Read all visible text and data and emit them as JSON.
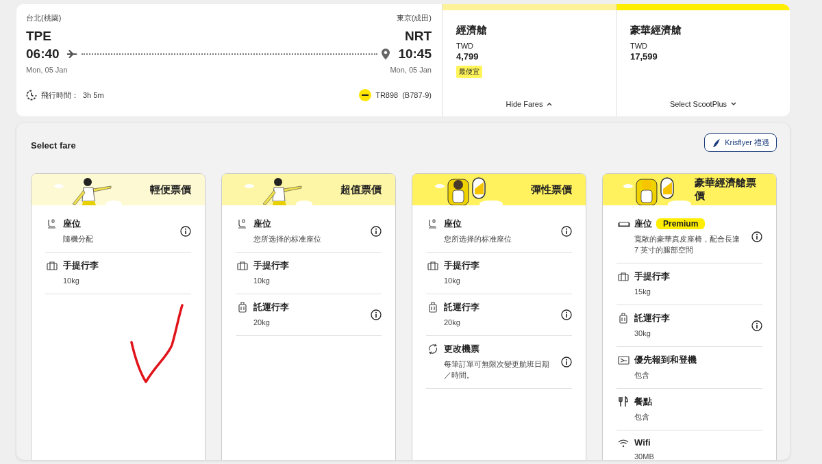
{
  "flight": {
    "origin_city": "台北(桃園)",
    "origin_code": "TPE",
    "depart_time": "06:40",
    "depart_date": "Mon, 05 Jan",
    "dest_city": "東京(成田)",
    "dest_code": "NRT",
    "arrive_time": "10:45",
    "arrive_date": "Mon, 05 Jan",
    "duration_label": "飛行時間：",
    "duration": "3h 5m",
    "flight_number": "TR898",
    "aircraft": "(B787-9)"
  },
  "cabins": [
    {
      "name": "經濟艙",
      "currency": "TWD",
      "price": "4,799",
      "badge": "最便宜",
      "toggle": "Hide Fares",
      "expanded": true
    },
    {
      "name": "豪華經濟艙",
      "currency": "TWD",
      "price": "17,599",
      "toggle": "Select ScootPlus",
      "expanded": false
    }
  ],
  "panel": {
    "title": "Select fare",
    "krisflyer_button": "Krisflyer 禮遇"
  },
  "fares": [
    {
      "name": "輕便票價",
      "color": "#fdf9d2",
      "features": [
        {
          "kind": "seat",
          "title": "座位",
          "detail": "隨機分配",
          "info": true
        },
        {
          "kind": "cabin-bag",
          "title": "手提行李",
          "detail": "10kg",
          "info": false
        }
      ]
    },
    {
      "name": "超值票價",
      "color": "#fdf6a6",
      "features": [
        {
          "kind": "seat",
          "title": "座位",
          "detail": "您所选择的标准座位",
          "info": true
        },
        {
          "kind": "cabin-bag",
          "title": "手提行李",
          "detail": "10kg",
          "info": false
        },
        {
          "kind": "checked-bag",
          "title": "託運行李",
          "detail": "20kg",
          "info": true
        }
      ]
    },
    {
      "name": "彈性票價",
      "color": "#fff25e",
      "features": [
        {
          "kind": "seat",
          "title": "座位",
          "detail": "您所选择的标准座位",
          "info": true
        },
        {
          "kind": "cabin-bag",
          "title": "手提行李",
          "detail": "10kg",
          "info": false
        },
        {
          "kind": "checked-bag",
          "title": "託運行李",
          "detail": "20kg",
          "info": true
        },
        {
          "kind": "change",
          "title": "更改機票",
          "detail": "每筆訂單可無限次變更航班日期／時間。",
          "info": true
        }
      ]
    },
    {
      "name": "豪華經濟艙票價",
      "color": "#fff25e",
      "features": [
        {
          "kind": "premium-seat",
          "title": "座位",
          "badge": "Premium",
          "detail": "寬敞的豪華真皮座椅，配合長達 7 英寸的腿部空間",
          "info": true
        },
        {
          "kind": "cabin-bag",
          "title": "手提行李",
          "detail": "15kg",
          "info": false
        },
        {
          "kind": "checked-bag",
          "title": "託運行李",
          "detail": "30kg",
          "info": true
        },
        {
          "kind": "priority",
          "title": "優先報到和登機",
          "detail": "包含",
          "info": false
        },
        {
          "kind": "meal",
          "title": "餐點",
          "detail": "包含",
          "info": false
        },
        {
          "kind": "wifi",
          "title": "Wifi",
          "detail": "30MB",
          "info": false
        }
      ]
    }
  ]
}
